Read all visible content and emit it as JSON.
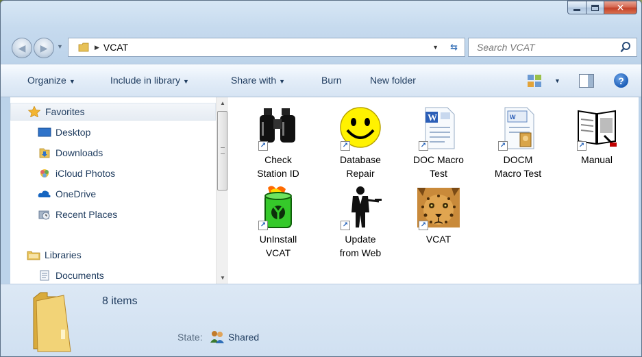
{
  "address": {
    "crumb": "VCAT"
  },
  "search": {
    "placeholder": "Search VCAT"
  },
  "toolbar": {
    "organize": "Organize",
    "include_in_library": "Include in library",
    "share_with": "Share with",
    "burn": "Burn",
    "new_folder": "New folder"
  },
  "navpane": {
    "favorites": "Favorites",
    "desktop": "Desktop",
    "downloads": "Downloads",
    "icloud_photos": "iCloud Photos",
    "onedrive": "OneDrive",
    "recent_places": "Recent Places",
    "libraries": "Libraries",
    "documents": "Documents"
  },
  "files": [
    {
      "name": "Check\nStation ID",
      "icon": "binoculars-icon"
    },
    {
      "name": "Database\nRepair",
      "icon": "smiley-icon"
    },
    {
      "name": "DOC Macro\nTest",
      "icon": "word-doc-icon"
    },
    {
      "name": "DOCM\nMacro Test",
      "icon": "word-docm-icon"
    },
    {
      "name": "Manual",
      "icon": "book-icon"
    },
    {
      "name": "UnInstall\nVCAT",
      "icon": "toxic-barrel-icon"
    },
    {
      "name": "Update\nfrom Web",
      "icon": "waiter-icon"
    },
    {
      "name": "VCAT",
      "icon": "leopard-icon"
    }
  ],
  "details": {
    "count": "8 items",
    "state_label": "State:",
    "state_value": "Shared"
  },
  "colors": {
    "accent": "#1e3b5e",
    "close": "#c4422a",
    "toolbar": "#e3edf8"
  }
}
